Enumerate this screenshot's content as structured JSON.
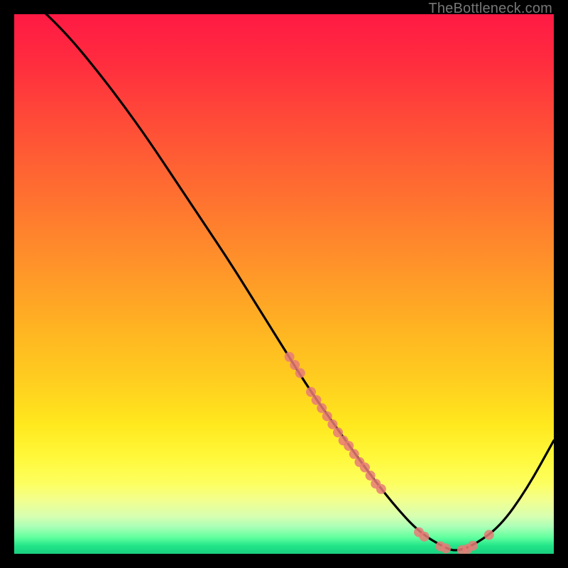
{
  "attribution": "TheBottleneck.com",
  "colors": {
    "background": "#000000",
    "curve": "#000000",
    "point": "#e87b77",
    "gradient_top": "#ff1a44",
    "gradient_bottom": "#1ad07f"
  },
  "chart_data": {
    "type": "line",
    "title": "",
    "xlabel": "",
    "ylabel": "",
    "xlim": [
      0,
      100
    ],
    "ylim": [
      0,
      100
    ],
    "grid": false,
    "legend": false,
    "axes_visible": false,
    "series": [
      {
        "name": "bottleneck-curve",
        "x": [
          0,
          5,
          10,
          15,
          20,
          25,
          30,
          35,
          40,
          45,
          50,
          55,
          60,
          65,
          70,
          75,
          80,
          82,
          85,
          90,
          95,
          100
        ],
        "y": [
          105,
          101,
          96,
          90,
          83.5,
          76.5,
          69,
          61.5,
          54,
          46,
          38,
          30,
          23,
          16,
          9.5,
          4,
          1,
          0.5,
          1.5,
          5,
          12,
          21
        ]
      }
    ],
    "scatter_points": {
      "name": "highlight-markers",
      "x": [
        51,
        52,
        53,
        55,
        56,
        57,
        58,
        59,
        60,
        61,
        62,
        63,
        64,
        65,
        66,
        67,
        68,
        75,
        76,
        79,
        80,
        83,
        84,
        85,
        88
      ],
      "y": [
        36.5,
        35,
        33.5,
        30,
        28.5,
        27,
        25.5,
        24,
        22.5,
        21,
        20,
        18.5,
        17,
        16,
        14.5,
        13,
        12,
        4,
        3.2,
        1.4,
        1.0,
        0.7,
        0.9,
        1.5,
        3.5
      ],
      "radius": 7
    },
    "notes": "Background is a vertical gradient from red (top, high bottleneck) through orange/yellow to green (bottom, optimal). Curve descends from upper-left, reaches a minimum near x≈82, then rises toward the right. Salmon markers cluster along the descending limb (~x 51–68) and around the trough (~x 75–88). No axis ticks, labels, or legend are visible."
  }
}
